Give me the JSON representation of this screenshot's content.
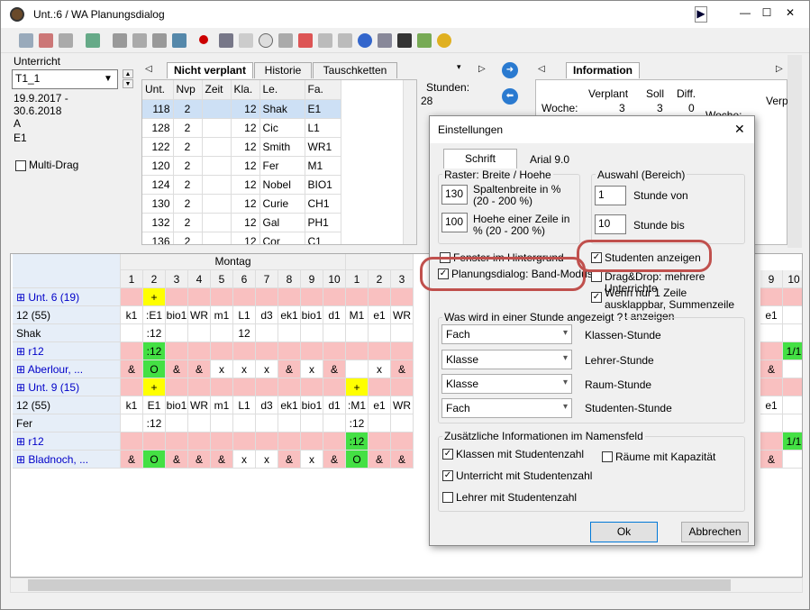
{
  "window": {
    "title": "Unt.:6 / WA  Planungsdialog"
  },
  "left": {
    "unterricht_label": "Unterricht",
    "unterricht_value": "T1_1",
    "date_from": "19.9.2017 -",
    "date_to": "30.6.2018",
    "line_a": "A",
    "line_e1": "E1",
    "multi_drag": "Multi-Drag"
  },
  "tabs": [
    "Nicht verplant",
    "Historie",
    "Tauschketten"
  ],
  "table": {
    "headers": [
      "Unt.",
      "Nvp",
      "Zeit",
      "Kla.",
      "Le.",
      "Fa."
    ],
    "rows": [
      [
        "118",
        "2",
        "",
        "12",
        "Shak",
        "E1"
      ],
      [
        "128",
        "2",
        "",
        "12",
        "Cic",
        "L1"
      ],
      [
        "122",
        "2",
        "",
        "12",
        "Smith",
        "WR1"
      ],
      [
        "120",
        "2",
        "",
        "12",
        "Fer",
        "M1"
      ],
      [
        "124",
        "2",
        "",
        "12",
        "Nobel",
        "BIO1"
      ],
      [
        "130",
        "2",
        "",
        "12",
        "Curie",
        "CH1"
      ],
      [
        "132",
        "2",
        "",
        "12",
        "Gal",
        "PH1"
      ],
      [
        "136",
        "2",
        "",
        "12",
        "Cor",
        "C1"
      ]
    ]
  },
  "stunden": {
    "label": "Stunden:",
    "value": "28"
  },
  "info": {
    "tab": "Information",
    "h1": "Verplant",
    "h2": "Soll",
    "h3": "Diff.",
    "woche": "Woche:",
    "v": "3",
    "s": "3",
    "d": "0",
    "verp": "Verp",
    "woche2": "Woche:"
  },
  "grid": {
    "day": "Montag",
    "periods": [
      "1",
      "2",
      "3",
      "4",
      "5",
      "6",
      "7",
      "8",
      "9",
      "10",
      "1",
      "2",
      "3"
    ],
    "right_periods": [
      "9",
      "10"
    ],
    "rows": [
      {
        "name": "Unt. 6 (19)",
        "blue": true,
        "cells": [
          "",
          "+",
          "",
          "",
          "",
          "",
          "",
          "",
          "",
          "",
          "",
          "",
          ""
        ],
        "right": [
          "",
          ""
        ]
      },
      {
        "name": "12 (55)",
        "blue": false,
        "cells": [
          "k1",
          ":E1",
          "bio1",
          "WR",
          "m1",
          "L1",
          "d3",
          "ek1",
          "bio1",
          "d1",
          "M1",
          "e1",
          "WR"
        ],
        "right": [
          "e1",
          ""
        ]
      },
      {
        "name": "Shak",
        "blue": false,
        "cells": [
          "",
          ":12",
          "",
          "",
          "",
          "12",
          "",
          "",
          "",
          "",
          "",
          "",
          ""
        ],
        "right": [
          "",
          ""
        ]
      },
      {
        "name": "r12",
        "blue": true,
        "cells": [
          "",
          ":12",
          "",
          "",
          "",
          "",
          "",
          "",
          "",
          "",
          "",
          "",
          ""
        ],
        "right": [
          "",
          "1/1"
        ]
      },
      {
        "name": "Aberlour, ...",
        "blue": true,
        "cells": [
          "&",
          "O",
          "&",
          "&",
          "x",
          "x",
          "x",
          "&",
          "x",
          "&",
          "",
          "x",
          "&"
        ],
        "right": [
          "&",
          ""
        ]
      },
      {
        "name": "Unt. 9 (15)",
        "blue": true,
        "cells": [
          "",
          "+",
          "",
          "",
          "",
          "",
          "",
          "",
          "",
          "",
          "+",
          "",
          ""
        ],
        "right": [
          "",
          ""
        ]
      },
      {
        "name": "12 (55)",
        "blue": false,
        "cells": [
          "k1",
          "E1",
          "bio1",
          "WR",
          "m1",
          "L1",
          "d3",
          "ek1",
          "bio1",
          "d1",
          ":M1",
          "e1",
          "WR"
        ],
        "right": [
          "e1",
          ""
        ]
      },
      {
        "name": "Fer",
        "blue": false,
        "cells": [
          "",
          ":12",
          "",
          "",
          "",
          "",
          "",
          "",
          "",
          "",
          ":12",
          "",
          ""
        ],
        "right": [
          "",
          ""
        ]
      },
      {
        "name": "r12",
        "blue": true,
        "cells": [
          "",
          "",
          "",
          "",
          "",
          "",
          "",
          "",
          "",
          "",
          ":12",
          "",
          ""
        ],
        "right": [
          "",
          "1/1"
        ]
      },
      {
        "name": "Bladnoch, ...",
        "blue": true,
        "cells": [
          "&",
          "O",
          "&",
          "&",
          "&",
          "x",
          "x",
          "&",
          "x",
          "&",
          "O",
          "&",
          "&"
        ],
        "right": [
          "&",
          ""
        ]
      }
    ]
  },
  "dialog": {
    "title": "Einstellungen",
    "schrift_btn": "Schrift",
    "font": "Arial 9.0",
    "raster_legend": "Raster: Breite / Hoehe",
    "spalten_val": "130",
    "spalten_lbl": "Spaltenbreite in % (20 - 200 %)",
    "hoehe_val": "100",
    "hoehe_lbl": "Hoehe einer Zeile in % (20 - 200 %)",
    "auswahl_legend": "Auswahl (Bereich)",
    "von_val": "1",
    "von_lbl": "Stunde von",
    "bis_val": "10",
    "bis_lbl": "Stunde bis",
    "fenster_hint": "Fenster im Hintergrund",
    "band_mode": "Planungsdialog: Band-Modus",
    "studenten": "Studenten anzeigen",
    "dragdrop": "Drag&Drop: mehrere Unterrichte",
    "wenn": "Wenn nur 1 Zeile ausklappbar, Summenzeile nicht anzeigen",
    "was_legend": "Was wird in einer Stunde angezeigt ?",
    "selects": [
      {
        "value": "Fach",
        "label": "Klassen-Stunde"
      },
      {
        "value": "Klasse",
        "label": "Lehrer-Stunde"
      },
      {
        "value": "Klasse",
        "label": "Raum-Stunde"
      },
      {
        "value": "Fach",
        "label": "Studenten-Stunde"
      }
    ],
    "zus_legend": "Zusätzliche Informationen im Namensfeld",
    "klassen": "Klassen mit Studentenzahl",
    "raeume": "Räume mit Kapazität",
    "unterricht": "Unterricht mit Studentenzahl",
    "lehrer": "Lehrer mit Studentenzahl",
    "ok": "Ok",
    "abbrechen": "Abbrechen"
  },
  "colors": {
    "pink": "#f9c0c0",
    "green": "#44e044",
    "yellow": "#ffff00",
    "lightgreen": "#c8f0c8",
    "blue": "#0000c8",
    "accent": "#c0504d"
  }
}
